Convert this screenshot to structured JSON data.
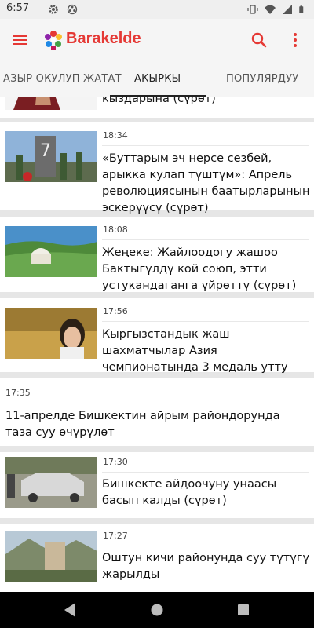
{
  "status_bar": {
    "time": "6:57"
  },
  "app_bar": {
    "title": "Barakelde"
  },
  "tabs": [
    {
      "label": "АЗЫР ОКУЛУП ЖАТАТ",
      "selected": false
    },
    {
      "label": "АКЫРКЫ",
      "selected": true
    },
    {
      "label": "ПОПУЛЯРДУУ",
      "selected": false
    }
  ],
  "feed": {
    "partial_top_title": "кыздарына (сүрөт)",
    "items": [
      {
        "time": "18:34",
        "title": "«Буттарым эч нерсе сезбей, арыкка кулап түштүм»: Апрель революциясынын баатырларынын эскерүүсү (сүрөт)",
        "image": "memorial-photo"
      },
      {
        "time": "18:08",
        "title": "Жеңеке: Жайлоодогу жашоо Бактыгүлдү кой союп, этти устукандаганга үйрөттү (сүрөт)",
        "image": "yurt-photo"
      },
      {
        "time": "17:56",
        "title": "Кыргызстандык жаш шахматчылар Азия чемпионатында 3 медаль утту",
        "image": "chess-girl-photo"
      },
      {
        "time": "17:35",
        "title": "11-апрелде Бишкектин айрым райондорунда таза суу өчүрүлөт",
        "image": null
      },
      {
        "time": "17:30",
        "title": "Бишкекте айдоочуну унаасы басып калды (сүрөт)",
        "image": "car-accident-photo"
      },
      {
        "time": "17:27",
        "title": "Оштун кичи районунда суу түтүгү жарылды",
        "image": "osh-district-photo"
      }
    ]
  },
  "colors": {
    "accent": "#e53935",
    "app_bar_bg": "#f5f5f5",
    "nav_bar_bg": "#000000"
  }
}
